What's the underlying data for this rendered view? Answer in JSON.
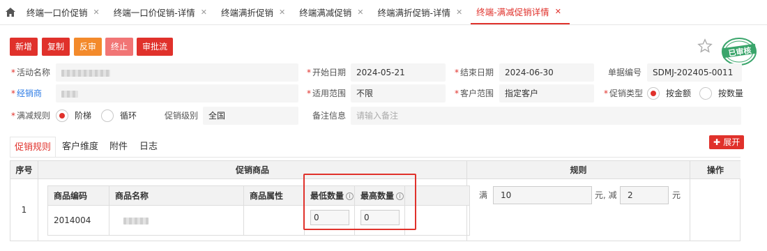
{
  "tabs": [
    {
      "label": "终端一口价促销",
      "active": false
    },
    {
      "label": "终端一口价促销-详情",
      "active": false
    },
    {
      "label": "终端满折促销",
      "active": false
    },
    {
      "label": "终端满减促销",
      "active": false
    },
    {
      "label": "终端满折促销-详情",
      "active": false
    },
    {
      "label": "终端-满减促销详情",
      "active": true
    }
  ],
  "toolbar": {
    "new": "新增",
    "copy": "复制",
    "unaudit": "反审",
    "terminate": "终止",
    "approval_flow": "审批流"
  },
  "stamp_text": "已审核",
  "form": {
    "activity_name_label": "活动名称",
    "start_date_label": "开始日期",
    "start_date": "2024-05-21",
    "end_date_label": "结束日期",
    "end_date": "2024-06-30",
    "doc_no_label": "单据编号",
    "doc_no": "SDMJ-202405-0011",
    "dealer_label": "经销商",
    "scope_label": "适用范围",
    "scope": "不限",
    "customer_scope_label": "客户范围",
    "customer_scope": "指定客户",
    "promo_type_label": "促销类型",
    "promo_type_amount": "按金额",
    "promo_type_qty": "按数量",
    "rule_label": "满减规则",
    "rule_ladder": "阶梯",
    "rule_loop": "循环",
    "level_label": "促销级别",
    "level": "全国",
    "remark_label": "备注信息",
    "remark_placeholder": "请输入备注"
  },
  "inner_tabs": [
    "促销规则",
    "客户维度",
    "附件",
    "日志"
  ],
  "expand_label": "展开",
  "table": {
    "headers": {
      "no": "序号",
      "products": "促销商品",
      "rules": "规则",
      "ops": "操作"
    },
    "row_no": "1",
    "product_headers": {
      "code": "商品编码",
      "name": "商品名称",
      "attr": "商品属性",
      "min_qty": "最低数量",
      "max_qty": "最高数量"
    },
    "product": {
      "code": "2014004",
      "min_qty": "0",
      "max_qty": "0"
    },
    "rule": {
      "prefix": "满",
      "full": "10",
      "mid": "元, 减",
      "minus": "2",
      "suffix": "元"
    }
  },
  "colors": {
    "accent": "#e0312b",
    "orange": "#f38a2b",
    "stamp": "#3aa56b"
  }
}
